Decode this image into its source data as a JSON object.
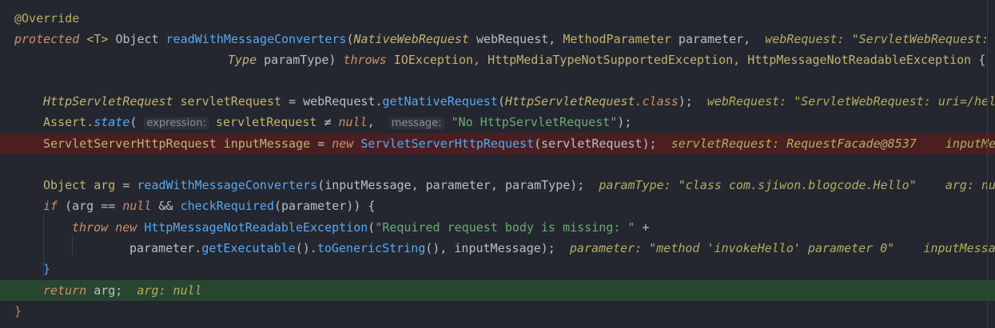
{
  "editor": {
    "language": "java",
    "lines": [
      {
        "tokens": [
          {
            "t": "@Override",
            "c": "ann"
          }
        ]
      },
      {
        "tokens": [
          {
            "t": "protected ",
            "c": "kw"
          },
          {
            "t": "<T> ",
            "c": "typ"
          },
          {
            "t": "Object ",
            "c": "cls"
          },
          {
            "t": "readWithMessageConverters",
            "c": "fn"
          },
          {
            "t": "(",
            "c": "op"
          },
          {
            "t": "NativeWebRequest ",
            "c": "ityp"
          },
          {
            "t": "webRequest, ",
            "c": "cls"
          },
          {
            "t": "MethodParameter ",
            "c": "typ"
          },
          {
            "t": "parameter,  ",
            "c": "cls"
          },
          {
            "t": "webRequest: \"ServletWebRequest: uri=/",
            "c": "hint"
          }
        ]
      },
      {
        "tokens": [
          {
            "t": "Type ",
            "c": "ityp"
          },
          {
            "t": "paramType) ",
            "c": "cls"
          },
          {
            "t": "throws ",
            "c": "kw"
          },
          {
            "t": "IOException, ",
            "c": "typ"
          },
          {
            "t": "HttpMediaTypeNotSupportedException, ",
            "c": "typ"
          },
          {
            "t": "HttpMessageNotReadableException ",
            "c": "typ"
          },
          {
            "t": "{",
            "c": "op"
          }
        ]
      },
      {
        "tokens": []
      },
      {
        "tokens": [
          {
            "t": "HttpServletRequest ",
            "c": "ityp"
          },
          {
            "t": "servletRequest ",
            "c": "typ"
          },
          {
            "t": "= ",
            "c": "op"
          },
          {
            "t": "webRequest.",
            "c": "cls"
          },
          {
            "t": "getNativeRequest",
            "c": "fn"
          },
          {
            "t": "(",
            "c": "op"
          },
          {
            "t": "HttpServletRequest",
            "c": "ityp"
          },
          {
            "t": ".class",
            "c": "kw"
          },
          {
            "t": ");  ",
            "c": "op"
          },
          {
            "t": "webRequest: \"ServletWebRequest: uri=/hel",
            "c": "hint"
          }
        ]
      },
      {
        "tokens": [
          {
            "t": "Assert.",
            "c": "typ"
          },
          {
            "t": "state",
            "c": "fn ital"
          },
          {
            "t": "( ",
            "c": "op"
          },
          {
            "t": "expression:",
            "c": "inlay"
          },
          {
            "t": " servletRequest ",
            "c": "typ"
          },
          {
            "t": "≠ ",
            "c": "op"
          },
          {
            "t": "null",
            "c": "kw"
          },
          {
            "t": ",  ",
            "c": "op"
          },
          {
            "t": "message:",
            "c": "inlay"
          },
          {
            "t": " \"No HttpServletRequest\"",
            "c": "str"
          },
          {
            "t": ");",
            "c": "op"
          }
        ]
      },
      {
        "tokens": [
          {
            "t": "ServletServerHttpRequest ",
            "c": "typ"
          },
          {
            "t": "inputMessage ",
            "c": "typ"
          },
          {
            "t": "= ",
            "c": "op"
          },
          {
            "t": "new ",
            "c": "kw"
          },
          {
            "t": "ServletServerHttpRequest",
            "c": "fn"
          },
          {
            "t": "(servletRequest);  ",
            "c": "cls"
          },
          {
            "t": "servletRequest: RequestFacade@8537    inputMe",
            "c": "hint"
          }
        ]
      },
      {
        "tokens": []
      },
      {
        "tokens": [
          {
            "t": "Object ",
            "c": "typ"
          },
          {
            "t": "arg ",
            "c": "typ"
          },
          {
            "t": "= ",
            "c": "op"
          },
          {
            "t": "readWithMessageConverters",
            "c": "fn"
          },
          {
            "t": "(inputMessage, parameter, paramType);  ",
            "c": "cls"
          },
          {
            "t": "paramType: \"class com.sjiwon.blogcode.Hello\"    arg: nu",
            "c": "hint"
          }
        ]
      },
      {
        "tokens": [
          {
            "t": "if ",
            "c": "kw"
          },
          {
            "t": "(arg ",
            "c": "cls"
          },
          {
            "t": "== ",
            "c": "op"
          },
          {
            "t": "null ",
            "c": "kw"
          },
          {
            "t": "&& ",
            "c": "op"
          },
          {
            "t": "checkRequired",
            "c": "fn"
          },
          {
            "t": "(parameter)) {",
            "c": "cls"
          }
        ]
      },
      {
        "tokens": [
          {
            "t": "throw ",
            "c": "kw"
          },
          {
            "t": "new ",
            "c": "kw"
          },
          {
            "t": "HttpMessageNotReadableException",
            "c": "fn"
          },
          {
            "t": "(",
            "c": "op"
          },
          {
            "t": "\"Required request body is missing: \" ",
            "c": "str"
          },
          {
            "t": "+",
            "c": "op"
          }
        ]
      },
      {
        "tokens": [
          {
            "t": "parameter.",
            "c": "cls"
          },
          {
            "t": "getExecutable",
            "c": "fn"
          },
          {
            "t": "().",
            "c": "op"
          },
          {
            "t": "toGenericString",
            "c": "fn"
          },
          {
            "t": "(), inputMessage);  ",
            "c": "cls"
          },
          {
            "t": "parameter: \"method 'invokeHello' parameter 0\"    inputMessa",
            "c": "hint"
          }
        ]
      },
      {
        "tokens": [
          {
            "t": "}",
            "c": "fn"
          }
        ]
      },
      {
        "tokens": [
          {
            "t": "return ",
            "c": "kw"
          },
          {
            "t": "arg;  ",
            "c": "cls"
          },
          {
            "t": "arg: null",
            "c": "hint"
          }
        ]
      },
      {
        "tokens": [
          {
            "t": "}",
            "c": "brace-red"
          }
        ]
      }
    ]
  },
  "colors": {
    "background": "#24272f",
    "execution_line": "#4b1f21",
    "current_line": "#284630"
  }
}
